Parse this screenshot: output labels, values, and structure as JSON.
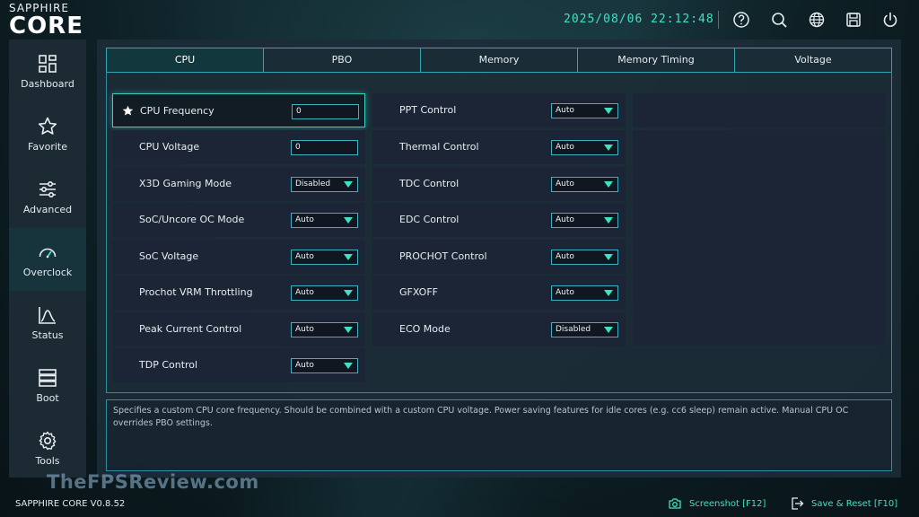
{
  "header": {
    "brand": "SAPPHIRE",
    "product": "CORE",
    "datetime": "2025/08/06 22:12:48",
    "icons": [
      "help-icon",
      "search-icon",
      "globe-icon",
      "save-icon",
      "power-icon"
    ]
  },
  "sidebar": {
    "items": [
      {
        "label": "Dashboard",
        "icon": "dashboard-icon"
      },
      {
        "label": "Favorite",
        "icon": "star-icon"
      },
      {
        "label": "Advanced",
        "icon": "sliders-icon"
      },
      {
        "label": "Overclock",
        "icon": "speedometer-icon"
      },
      {
        "label": "Status",
        "icon": "chart-icon"
      },
      {
        "label": "Boot",
        "icon": "boot-icon"
      },
      {
        "label": "Tools",
        "icon": "gear-icon"
      }
    ],
    "active": "Overclock"
  },
  "tabs": [
    {
      "label": "CPU"
    },
    {
      "label": "PBO"
    },
    {
      "label": "Memory"
    },
    {
      "label": "Memory Timing"
    },
    {
      "label": "Voltage"
    }
  ],
  "settings_left": [
    {
      "label": "CPU Frequency",
      "value": "0",
      "kind": "input"
    },
    {
      "label": "CPU Voltage",
      "value": "0",
      "kind": "input"
    },
    {
      "label": "X3D Gaming Mode",
      "value": "Disabled",
      "kind": "select"
    },
    {
      "label": "SoC/Uncore OC Mode",
      "value": "Auto",
      "kind": "select"
    },
    {
      "label": "SoC Voltage",
      "value": "Auto",
      "kind": "select"
    },
    {
      "label": "Prochot VRM Throttling",
      "value": "Auto",
      "kind": "select"
    },
    {
      "label": "Peak Current Control",
      "value": "Auto",
      "kind": "select"
    },
    {
      "label": "TDP Control",
      "value": "Auto",
      "kind": "select"
    }
  ],
  "settings_right": [
    {
      "label": "PPT Control",
      "value": "Auto",
      "kind": "select"
    },
    {
      "label": "Thermal Control",
      "value": "Auto",
      "kind": "select"
    },
    {
      "label": "TDC Control",
      "value": "Auto",
      "kind": "select"
    },
    {
      "label": "EDC Control",
      "value": "Auto",
      "kind": "select"
    },
    {
      "label": "PROCHOT Control",
      "value": "Auto",
      "kind": "select"
    },
    {
      "label": "GFXOFF",
      "value": "Auto",
      "kind": "select"
    },
    {
      "label": "ECO Mode",
      "value": "Disabled",
      "kind": "select"
    }
  ],
  "description": "Specifies a custom CPU core frequency. Should be combined with a custom CPU voltage. Power saving features for idle cores (e.g. cc6 sleep) remain active. Manual CPU OC overrides PBO settings.",
  "watermark": "TheFPSReview.com",
  "footer": {
    "version": "SAPPHIRE CORE V0.8.52",
    "screenshot_label": "Screenshot [F12]",
    "save_reset_label": "Save & Reset [F10]"
  },
  "colors": {
    "accent": "#40e0c4",
    "tab_border": "#2fa5b5",
    "row_bg": "#1c2536",
    "sidebar_bg": "#1b2a33"
  }
}
